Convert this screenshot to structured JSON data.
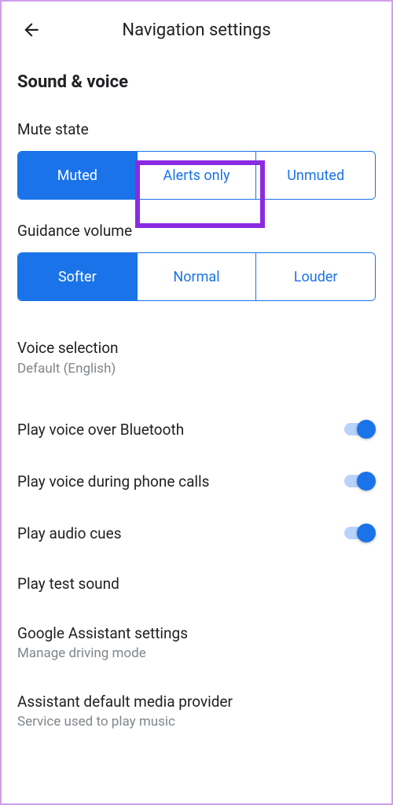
{
  "header": {
    "title": "Navigation settings"
  },
  "section": {
    "heading": "Sound & voice"
  },
  "muteState": {
    "label": "Mute state",
    "options": [
      "Muted",
      "Alerts only",
      "Unmuted"
    ],
    "selected": 0,
    "highlighted": 1
  },
  "guidanceVolume": {
    "label": "Guidance volume",
    "options": [
      "Softer",
      "Normal",
      "Louder"
    ],
    "selected": 0
  },
  "voiceSelection": {
    "title": "Voice selection",
    "value": "Default (English)"
  },
  "toggles": {
    "bluetooth": {
      "label": "Play voice over Bluetooth",
      "on": true
    },
    "phoneCalls": {
      "label": "Play voice during phone calls",
      "on": true
    },
    "audioCues": {
      "label": "Play audio cues",
      "on": true
    }
  },
  "testSound": {
    "label": "Play test sound"
  },
  "assistant": {
    "title": "Google Assistant settings",
    "subtitle": "Manage driving mode"
  },
  "mediaProvider": {
    "title": "Assistant default media provider",
    "subtitle": "Service used to play music"
  }
}
